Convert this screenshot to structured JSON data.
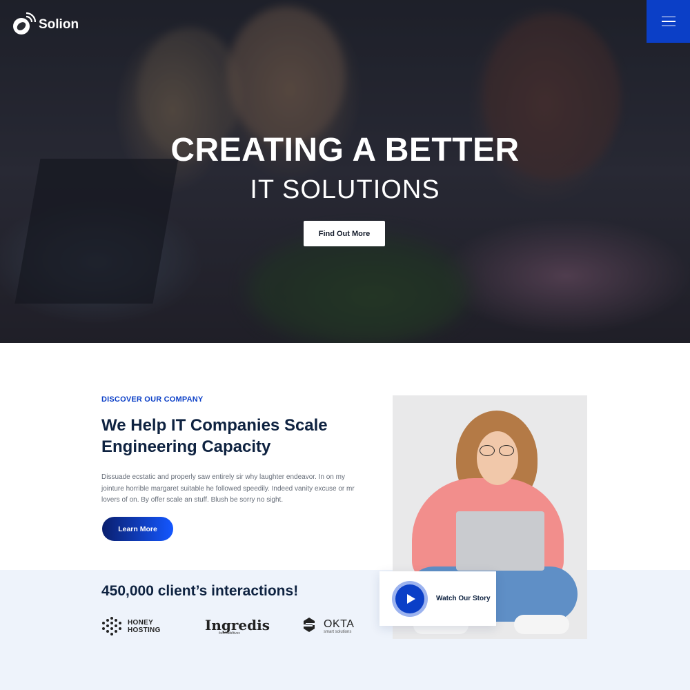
{
  "brand": {
    "name": "Solion"
  },
  "hero": {
    "title": "CREATING A BETTER",
    "subtitle": "IT SOLUTIONS",
    "cta_label": "Find Out More"
  },
  "about": {
    "eyebrow": "DISCOVER OUR COMPANY",
    "title": "We Help IT Companies Scale Engineering Capacity",
    "text": "Dissuade ecstatic and properly saw entirely sir why laughter endeavor. In on my jointure horrible margaret suitable he followed speedily. Indeed vanity excuse or mr lovers of on. By offer scale an stuff. Blush be sorry no sight.",
    "button_label": "Learn More"
  },
  "stats": {
    "title": "450,000 client’s interactions!"
  },
  "partners": [
    {
      "name_line1": "HONEY",
      "name_line2": "HOSTING",
      "icon": "honeycomb-dots-icon"
    },
    {
      "name": "Ingredis",
      "tagline": "food additives"
    },
    {
      "name": "OKTA",
      "tagline": "smart solutions",
      "icon": "okta-s-icon"
    }
  ],
  "video": {
    "label": "Watch Our Story",
    "icon": "play-icon"
  },
  "colors": {
    "accent": "#0b3fc7",
    "heading": "#0e2240",
    "band": "#eef3fb"
  },
  "icons": {
    "menu": "hamburger-menu-icon",
    "logo": "satellite-dish-icon"
  }
}
